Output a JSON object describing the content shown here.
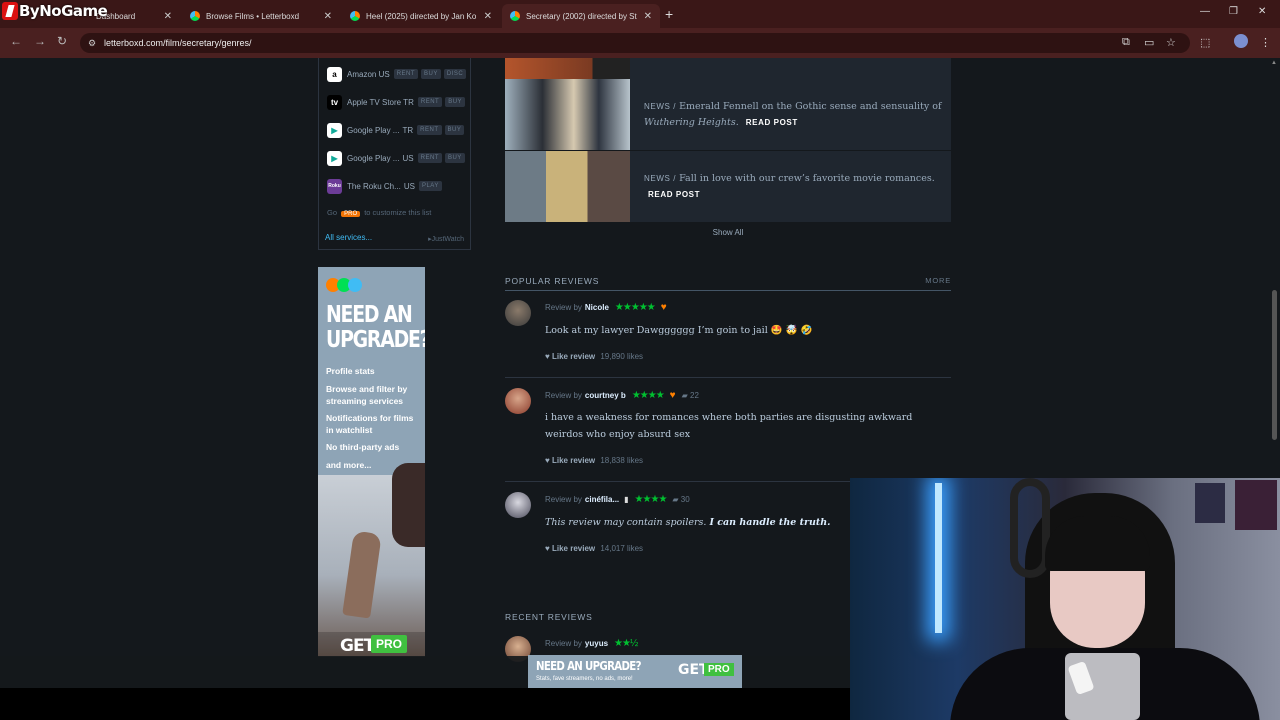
{
  "overlay_logo": "ByNoGame",
  "browser": {
    "tabs": [
      {
        "title": "Dashboard",
        "fav": "#e04040"
      },
      {
        "title": "Browse Films • Letterboxd",
        "fav": "#44a0c0"
      },
      {
        "title": "Heel (2025) directed by Jan Ko",
        "fav": "#44a0c0"
      },
      {
        "title": "Secretary (2002) directed by St",
        "fav": "#44a0c0"
      }
    ],
    "url": "letterboxd.com/film/secretary/genres/"
  },
  "services": [
    {
      "name": "Amazon US",
      "icon": "amazon-icon",
      "tags": [
        "RENT",
        "BUY",
        "DISC"
      ]
    },
    {
      "name": "Apple TV Store TR",
      "icon": "apple-tv-icon",
      "tags": [
        "RENT",
        "BUY"
      ]
    },
    {
      "name": "Google Play ...",
      "country": "TR",
      "icon": "google-play-icon",
      "tags": [
        "RENT",
        "BUY"
      ]
    },
    {
      "name": "Google Play ...",
      "country": "US",
      "icon": "google-play-icon",
      "tags": [
        "RENT",
        "BUY"
      ]
    },
    {
      "name": "The Roku Ch...",
      "country": "US",
      "icon": "roku-icon",
      "tags": [
        "PLAY"
      ]
    }
  ],
  "customize": {
    "pre": "Go",
    "pro": "PRO",
    "post": "to customize this list"
  },
  "all_services": "All services...",
  "justwatch": "JustWatch",
  "ad": {
    "headline": "NEED AN UPGRADE?",
    "features": [
      "Profile stats",
      "Browse and filter by streaming services",
      "Notifications for films in watchlist",
      "No third-party ads",
      "and more..."
    ],
    "get": "GET",
    "pro": "PRO"
  },
  "news": [
    {
      "kind": "NEWS /",
      "text": "Emerald Fennell on the Gothic sense and sensuality of",
      "italic": "Wuthering Heights",
      "tail": ".",
      "read": "READ POST"
    },
    {
      "kind": "NEWS /",
      "text": "Fall in love with our crew’s favorite movie romances.",
      "italic": "",
      "tail": "",
      "read": "READ POST"
    }
  ],
  "show_all": "Show All",
  "popular_reviews": {
    "heading": "POPULAR REVIEWS",
    "more": "MORE",
    "items": [
      {
        "prefix": "Review by",
        "user": "Nicole",
        "stars": "★★★★★",
        "liked": true,
        "comments": "",
        "text": "Look at my lawyer Dawgggggg I’m goin to jail 🤩 🤯 🤣",
        "like_label": "Like review",
        "likes": "19,890 likes"
      },
      {
        "prefix": "Review by",
        "user": "courtney b",
        "stars": "★★★★",
        "liked": true,
        "comments": "22",
        "text": "i have a weakness for romances where both parties are disgusting awkward weirdos who enjoy absurd sex",
        "like_label": "Like review",
        "likes": "18,838 likes"
      },
      {
        "prefix": "Review by",
        "user": "cinéfila...",
        "stars": "★★★★",
        "liked": false,
        "comments": "30",
        "text_italic": "This review may contain spoilers.",
        "text_bold": "I can handle the truth.",
        "like_label": "Like review",
        "likes": "14,017 likes"
      }
    ]
  },
  "recent_reviews": {
    "heading": "RECENT REVIEWS",
    "items": [
      {
        "prefix": "Review by",
        "user": "yuyus",
        "stars": "★★½"
      }
    ]
  },
  "bottom_ad": {
    "headline": "NEED AN UPGRADE?",
    "sub": "Stats, fave streamers, no ads, more!",
    "get": "GET",
    "pro": "PRO"
  }
}
